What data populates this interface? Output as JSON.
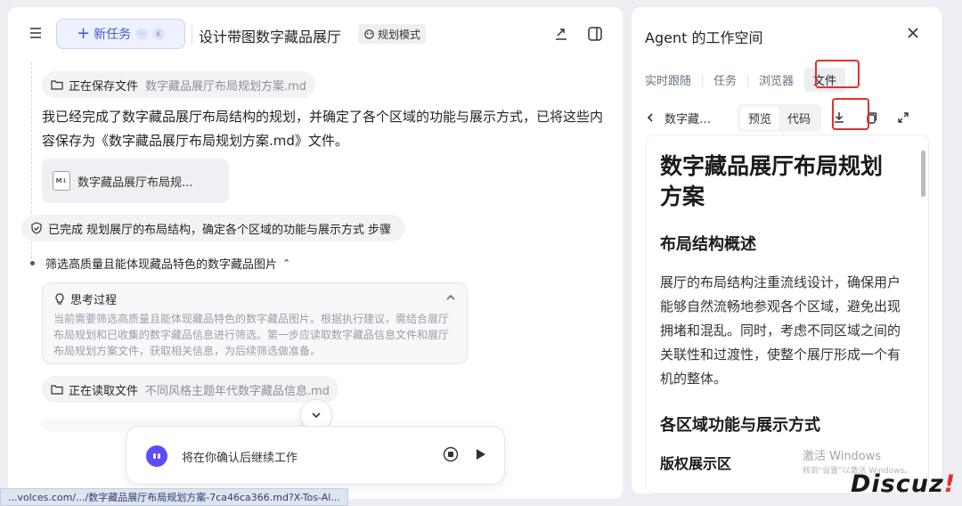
{
  "left_panel": {
    "header": {
      "new_task_label": "新任务",
      "shortcut_a": "···",
      "shortcut_b": "K",
      "title": "设计带图数字藏品展厅",
      "mode_badge": "规划模式"
    },
    "saving_chip": {
      "label": "正在保存文件",
      "filename": "数字藏品展厅布局规划方案.md"
    },
    "message": "我已经完成了数字藏品展厅布局结构的规划，并确定了各个区域的功能与展示方式，已将这些内容保存为《数字藏品展厅布局规划方案.md》文件。",
    "file_card": {
      "icon_text": "M↓",
      "name": "数字藏品展厅布局规..."
    },
    "completed_step": {
      "prefix": "已完成",
      "text": "规划展厅的布局结构，确定各个区域的功能与展示方式",
      "suffix": "步骤"
    },
    "current_step": {
      "text": "筛选高质量且能体现藏品特色的数字藏品图片"
    },
    "thinking": {
      "title": "思考过程",
      "body": "当前需要筛选高质量且能体现藏品特色的数字藏品图片。根据执行建议，需结合展厅布局规划和已收集的数字藏品信息进行筛选。第一步应读取数字藏品信息文件和展厅布局规划方案文件，获取相关信息，为后续筛选做准备。"
    },
    "reading_chip": {
      "label": "正在读取文件",
      "filename": "不同风格主题年代数字藏品信息.md"
    },
    "input": {
      "placeholder": "将在你确认后继续工作"
    }
  },
  "status_bar": {
    "url": "...volces.com/.../数字藏品展厅布局规划方案-7ca46ca366.md?X-Tos-Al..."
  },
  "right_panel": {
    "title": "Agent 的工作空间",
    "tabs": [
      {
        "label": "实时跟随",
        "active": false
      },
      {
        "label": "任务",
        "active": false
      },
      {
        "label": "浏览器",
        "active": false
      },
      {
        "label": "文件",
        "active": true
      }
    ],
    "file_toolbar": {
      "filename": "数字藏品展厅布局规划方案.md",
      "preview": "预览",
      "code": "代码"
    },
    "document": {
      "h1": "数字藏品展厅布局规划方案",
      "section1_title": "布局结构概述",
      "section1_text": "展厅的布局结构注重流线设计，确保用户能够自然流畅地参观各个区域，避免出现拥堵和混乱。同时，考虑不同区域之间的关联性和过渡性，使整个展厅形成一个有机的整体。",
      "section2_title": "各区域功能与展示方式",
      "section3_title": "版权展示区"
    }
  },
  "overlay": {
    "watermark_line1": "激活 Windows",
    "watermark_line2": "转到\"设置\"以激活 Windows。",
    "discuz_text": "Discuz",
    "discuz_bang": "!"
  },
  "colors": {
    "accent": "#3f5bd8",
    "highlight": "#e0312b",
    "avatar": "#5b4cf5"
  }
}
